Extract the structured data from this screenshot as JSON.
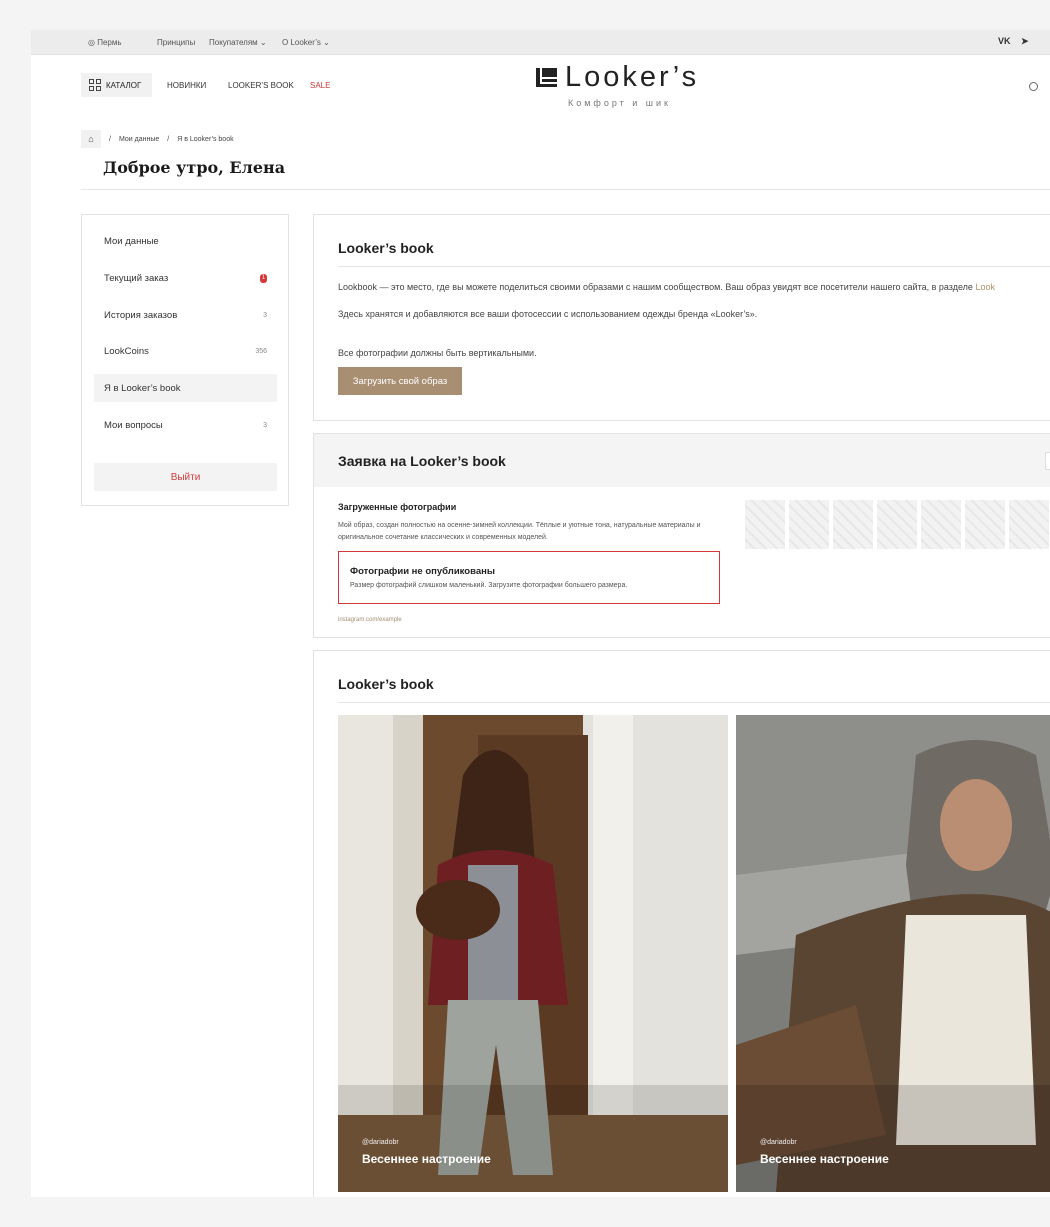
{
  "topbar": {
    "city": "Пермь",
    "links": [
      "Принципы",
      "Покупателям",
      "О Looker’s"
    ],
    "social": [
      "VK",
      "➤"
    ]
  },
  "header": {
    "catalog_label": "КАТАЛОГ",
    "nav": [
      "НОВИНКИ",
      "LOOKER’S BOOK",
      "SALE"
    ],
    "logo_text": "Looker’s",
    "tagline": "Комфорт и шик"
  },
  "breadcrumb": {
    "items": [
      "Мои данные",
      "Я в Looker’s book"
    ]
  },
  "greeting": "Доброе утро, Елена",
  "sidebar": {
    "items": [
      {
        "label": "Мои данные",
        "count": ""
      },
      {
        "label": "Текущий заказ",
        "count": "1"
      },
      {
        "label": "История заказов",
        "count": "3"
      },
      {
        "label": "LookCoins",
        "count": "356"
      },
      {
        "label": "Я в Looker’s book",
        "count": ""
      },
      {
        "label": "Мои вопросы",
        "count": "3"
      }
    ],
    "logout": "Выйти"
  },
  "book_card": {
    "title": "Looker’s book",
    "text1": "Lookbook — это место, где вы можете поделиться своими образами с нашим сообществом. Ваш образ увидят все посетители нашего сайта, в разделе",
    "text1_link": "Look",
    "text2": "Здесь хранятся и добавляются все ваши фотосессии с использованием одежды бренда «Looker’s».",
    "text3": "Все фотографии должны быть вертикальными.",
    "upload_button": "Загрузить свой образ"
  },
  "request_card": {
    "title": "Заявка на Looker’s book",
    "uploaded_title": "Загруженные фотографии",
    "description": "Мой образ, создан полностью на осенне-зимней коллекции. Тёплые и уютные тона, натуральные материалы и оригинальное сочетание классических и современных моделей.",
    "error_title": "Фотографии не опубликованы",
    "error_text": "Размер фотографий слишком маленький. Загрузите фотографии большего размера.",
    "instagram": "instagram.com/example"
  },
  "gallery": {
    "title": "Looker’s book",
    "items": [
      {
        "handle": "@dariadobr",
        "title": "Весеннее настроение"
      },
      {
        "handle": "@dariadobr",
        "title": "Весеннее настроение"
      }
    ]
  },
  "colors": {
    "accent": "#a98f72",
    "sale": "#c8363b",
    "error": "#d2373a"
  }
}
